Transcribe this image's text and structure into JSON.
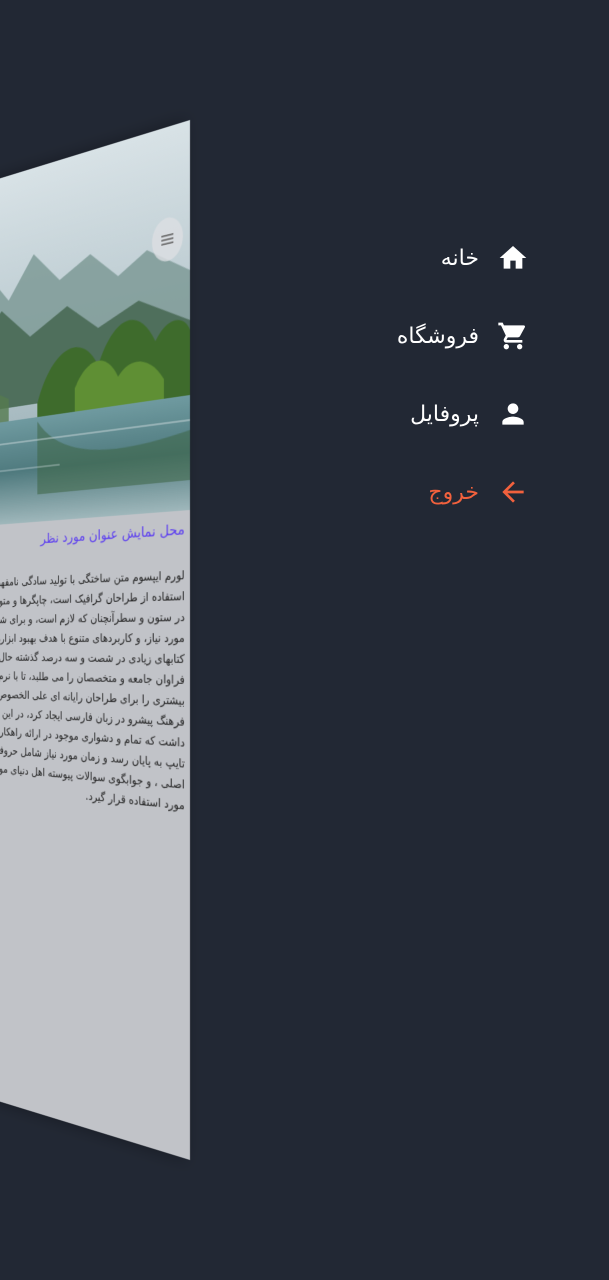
{
  "page_card": {
    "title": "محل نمایش عنوان مورد نظر",
    "body": "لورم ایپسوم متن ساختگی با تولید سادگی نامفهوم از صنعت چاپ، و با استفاده از طراحان گرافیک است، چاپگرها و متون بلکه روزنامه و مجله در ستون و سطرآنچنان که لازم است، و برای شرایط فعلی تکنولوژی مورد نیاز، و کاربردهای متنوع با هدف بهبود ابزارهای کاربردی می باشد، کتابهای زیادی در شصت و سه درصد گذشته حال و آینده، شناخت فراوان جامعه و متخصصان را می طلبد، تا با نرم افزارها شناخت بیشتری را برای طراحان رایانه ای علی الخصوص طراحان خلاقی، و فرهنگ پیشرو در زبان فارسی ایجاد کرد، در این صورت می توان امید داشت که تمام و دشواری موجود در ارائه راهکارها، و شرایط سخت تایپ به پایان رسد و زمان مورد نیاز شامل حروفچینی دستاوردهای اصلی ، و جوابگوی سوالات پیوسته اهل دنیای موجود طراحی اساسا مورد استفاده قرار گیرد.",
    "menu_icon": "hamburger-menu-icon"
  },
  "drawer": {
    "items": [
      {
        "label": "خانه",
        "icon": "home-icon"
      },
      {
        "label": "فروشگاه",
        "icon": "cart-icon"
      },
      {
        "label": "پروفایل",
        "icon": "person-icon"
      },
      {
        "label": "خروج",
        "icon": "arrow-back-icon"
      }
    ]
  },
  "colors": {
    "background": "#222834",
    "drawer_text": "#ffffff",
    "logout_accent": "#f2613d",
    "title_accent": "#5b3df0",
    "page_background": "#c1c3c8"
  }
}
